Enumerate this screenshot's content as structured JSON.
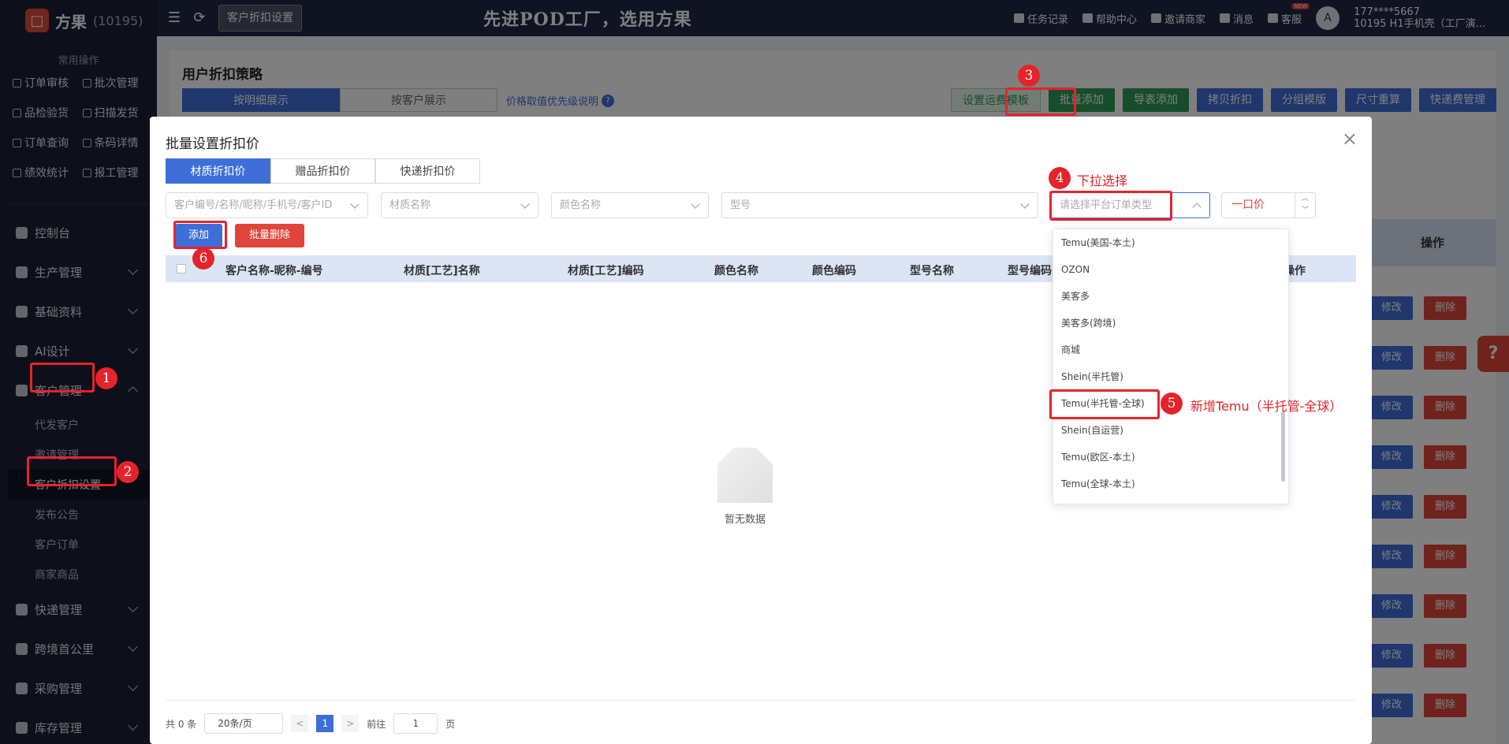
{
  "app": {
    "logo_char": "□",
    "name": "方果",
    "id": "(10195)"
  },
  "sidebar": {
    "common_title": "常用操作",
    "quick": [
      "订单审核",
      "批次管理",
      "品检验货",
      "扫描发货",
      "订单查询",
      "条码详情",
      "绩效统计",
      "报工管理"
    ],
    "nav": [
      {
        "label": "控制台"
      },
      {
        "label": "生产管理"
      },
      {
        "label": "基础资料"
      },
      {
        "label": "AI设计"
      },
      {
        "label": "客户管理"
      }
    ],
    "sub": [
      "代发客户",
      "邀请管理",
      "客户折扣设置",
      "发布公告",
      "客户订单",
      "商家商品"
    ],
    "nav2": [
      {
        "label": "快递管理"
      },
      {
        "label": "跨境首公里"
      },
      {
        "label": "采购管理"
      },
      {
        "label": "库存管理"
      }
    ]
  },
  "topbar": {
    "tab": "客户折扣设置",
    "banner": "先进POD工厂，选用方果",
    "links": [
      "任务记录",
      "帮助中心",
      "邀请商家",
      "消息",
      "客服"
    ],
    "new_badge": "NEW",
    "avatar": "A",
    "user_phone": "177****5667",
    "user_org": "10195 H1手机壳（工厂演..."
  },
  "page": {
    "title": "用户折扣策略",
    "seg": [
      "按明细展示",
      "按客户展示"
    ],
    "priority_link": "价格取值优先级说明",
    "qmark": "?",
    "toolbar": [
      "设置运费模板",
      "批量添加",
      "导表添加",
      "拷贝折扣",
      "分组模版",
      "尺寸重算",
      "快递费管理"
    ],
    "op_header": "操作",
    "edit": "修改",
    "delete": "删除",
    "help_float": "?"
  },
  "dialog": {
    "title": "批量设置折扣价",
    "close": "×",
    "tabs": [
      "材质折扣价",
      "赠品折扣价",
      "快递折扣价"
    ],
    "filters": {
      "customer": "客户编号/名称/昵称/手机号/客户ID",
      "material": "材质名称",
      "color": "颜色名称",
      "model": "型号",
      "platform": "请选择平台订单类型"
    },
    "price_value": "一口价",
    "step_up": "︿",
    "step_down": "﹀",
    "add": "添加",
    "batch_delete": "批量删除",
    "columns": [
      "客户名称-昵称-编号",
      "材质[工艺]名称",
      "材质[工艺]编码",
      "颜色名称",
      "颜色编码",
      "型号名称",
      "型号编码",
      "操作"
    ],
    "empty": "暂无数据",
    "pager": {
      "total": "共 0 条",
      "size": "20条/页",
      "prev": "<",
      "page": "1",
      "next": ">",
      "goto": "前往",
      "goto_val": "1",
      "unit": "页"
    }
  },
  "dropdown": {
    "items": [
      "Temu(美国-本土)",
      "OZON",
      "美客多",
      "美客多(跨境)",
      "商城",
      "Shein(半托管)",
      "Temu(半托管-全球)",
      "Shein(自运营)",
      "Temu(欧区-本土)",
      "Temu(全球-本土)"
    ]
  },
  "annotations": {
    "n1": "1",
    "n2": "2",
    "n3": "3",
    "n4": "4",
    "n5": "5",
    "n6": "6",
    "t4": "下拉选择",
    "t5": "新增Temu（半托管-全球）",
    "color": "#e5232b"
  }
}
